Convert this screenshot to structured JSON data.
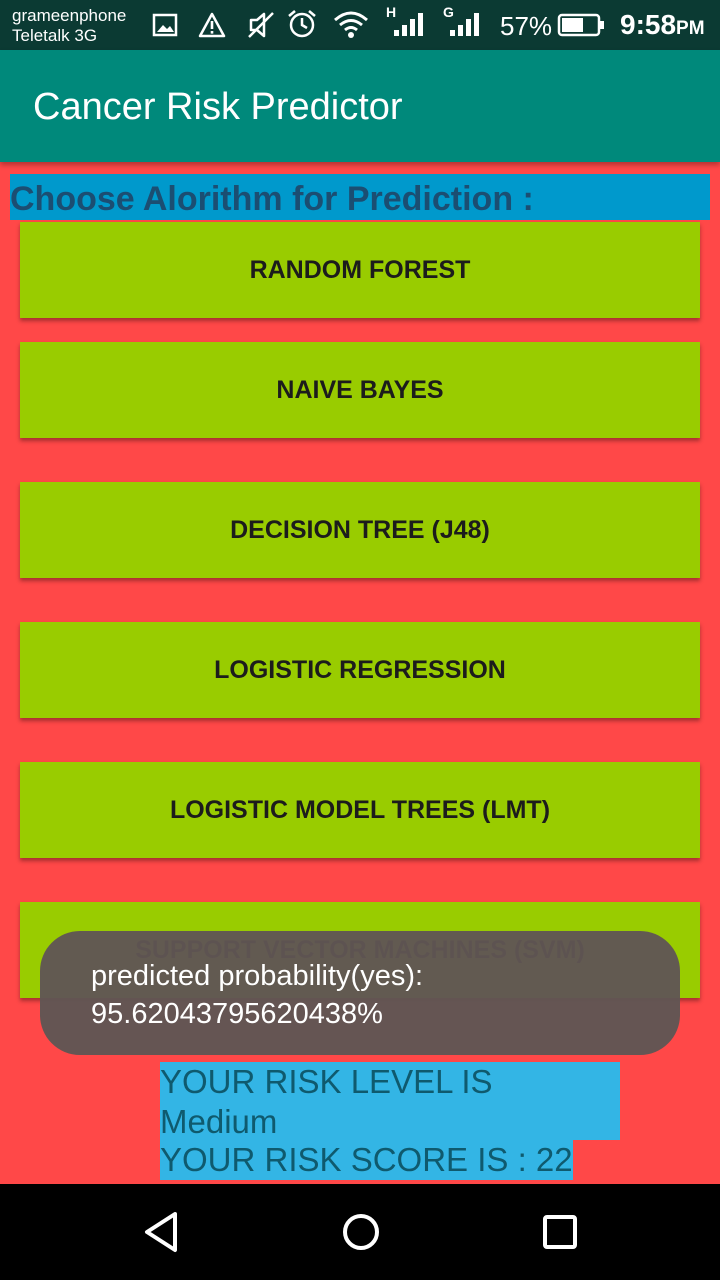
{
  "status_bar": {
    "carrier_line1": "grameenphone",
    "carrier_line2": "Teletalk 3G",
    "signal1_label": "H",
    "signal2_label": "G",
    "battery_percent": "57%",
    "time": "9:58",
    "time_suffix": "PM",
    "icons": [
      "image-icon",
      "warning-icon",
      "mute-icon",
      "alarm-icon",
      "wifi-icon",
      "signal-icon",
      "signal-icon",
      "battery-icon"
    ]
  },
  "app_bar": {
    "title": "Cancer Risk Predictor",
    "color": "#00897b"
  },
  "main": {
    "background": "#ff4848",
    "heading": "Choose Alorithm for Prediction :",
    "buttons": [
      "RANDOM FOREST",
      "NAIVE BAYES",
      "DECISION TREE (J48)",
      "LOGISTIC REGRESSION",
      "LOGISTIC MODEL TREES (LMT)",
      "SUPPORT VECTOR MACHINES (SVM)"
    ],
    "button_color": "#99cc00",
    "result": {
      "level_line1": "YOUR RISK LEVEL IS",
      "level_line2": "Medium",
      "score_line": "YOUR RISK SCORE IS : 22"
    }
  },
  "toast": {
    "line1": "predicted probability(yes):",
    "line2": "95.62043795620438%"
  },
  "nav_bar": {
    "icons": [
      "back-icon",
      "home-icon",
      "recents-icon"
    ]
  }
}
